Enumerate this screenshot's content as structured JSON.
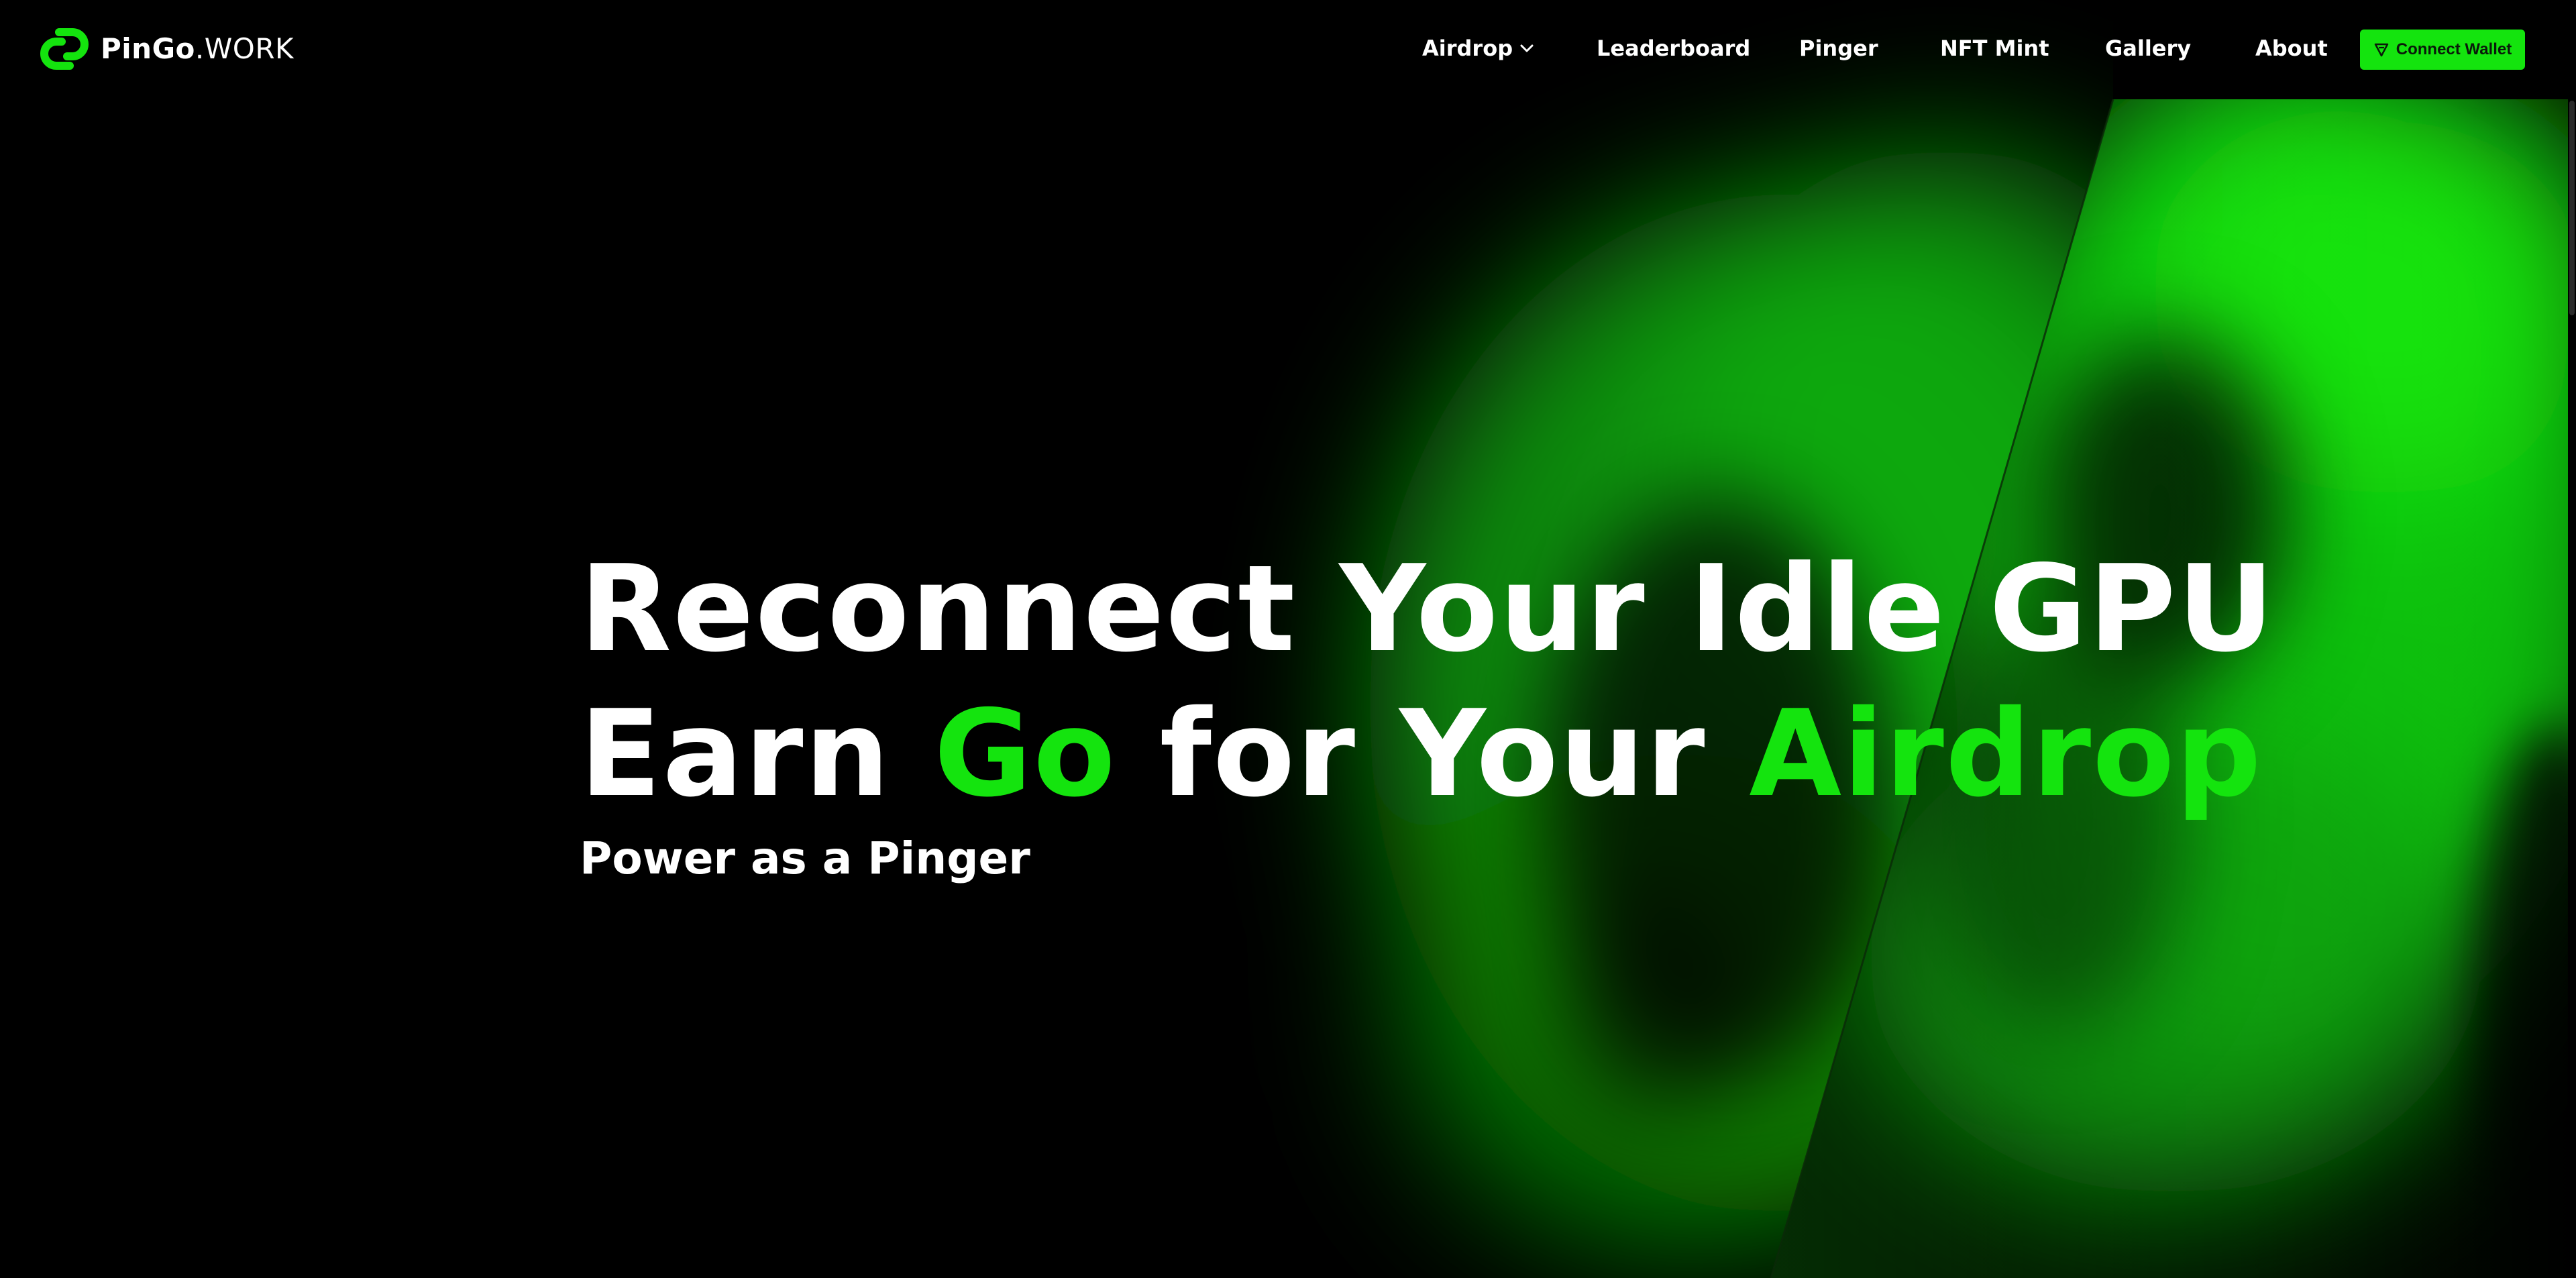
{
  "header": {
    "logo": {
      "brand_bold": "PinGo",
      "brand_light": ".WORK"
    },
    "nav": [
      {
        "label": "Airdrop",
        "has_dropdown": true
      },
      {
        "label": "Leaderboard"
      },
      {
        "label": "Pinger"
      },
      {
        "label": "NFT Mint"
      },
      {
        "label": "Gallery"
      },
      {
        "label": "About"
      }
    ],
    "connect_wallet": {
      "label": "Connect Wallet",
      "icon": "wallet-icon"
    }
  },
  "hero": {
    "line1": "Reconnect Your Idle GPU",
    "line2": {
      "part1": "Earn ",
      "accent1": "Go",
      "part2": " for Your ",
      "accent2": "Airdrop"
    },
    "subtitle": "Power as a Pinger"
  },
  "colors": {
    "accent": "#14e40e",
    "background": "#000000"
  }
}
